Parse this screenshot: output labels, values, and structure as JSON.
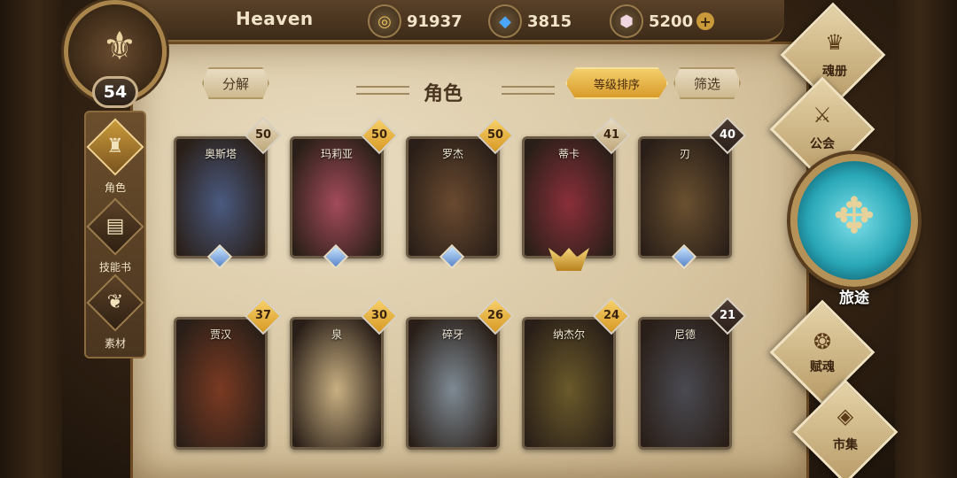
{
  "player": {
    "name": "Heaven",
    "level": "54"
  },
  "currencies": [
    {
      "icon": "gold-coin-icon",
      "value": "91937"
    },
    {
      "icon": "blue-crystal-icon",
      "value": "3815"
    },
    {
      "icon": "gem-stone-icon",
      "value": "5200",
      "plus": "+"
    }
  ],
  "left_nav": [
    {
      "label": "角色",
      "icon": "character-icon",
      "active": true
    },
    {
      "label": "技能书",
      "icon": "skill-book-icon",
      "active": false
    },
    {
      "label": "素材",
      "icon": "material-icon",
      "active": false
    }
  ],
  "header": {
    "decompose": "分解",
    "title": "角色",
    "sort": "等级排序",
    "filter": "筛选"
  },
  "characters": [
    {
      "name": "奥斯塔",
      "level": "50",
      "badge": "tan",
      "bg": "#4a5a80"
    },
    {
      "name": "玛莉亚",
      "level": "50",
      "badge": "gold",
      "bg": "#a34b5a"
    },
    {
      "name": "罗杰",
      "level": "50",
      "badge": "gold",
      "bg": "#6a4a30"
    },
    {
      "name": "蒂卡",
      "level": "41",
      "badge": "tan",
      "bg": "#8a2f3a"
    },
    {
      "name": "刃",
      "level": "40",
      "badge": "dark",
      "bg": "#6a5030"
    },
    {
      "name": "贾汉",
      "level": "37",
      "badge": "gold",
      "bg": "#7a3a22"
    },
    {
      "name": "泉",
      "level": "30",
      "badge": "gold",
      "bg": "#c9b082"
    },
    {
      "name": "碎牙",
      "level": "26",
      "badge": "gold",
      "bg": "#7e8a94"
    },
    {
      "name": "纳杰尔",
      "level": "24",
      "badge": "gold",
      "bg": "#6a5a2a"
    },
    {
      "name": "尼德",
      "level": "21",
      "badge": "dark",
      "bg": "#4a4a52"
    }
  ],
  "right_menu": {
    "soul_book": "魂册",
    "guild": "公会",
    "journey": "旅途",
    "soul_gift": "赋魂",
    "market": "市集"
  }
}
